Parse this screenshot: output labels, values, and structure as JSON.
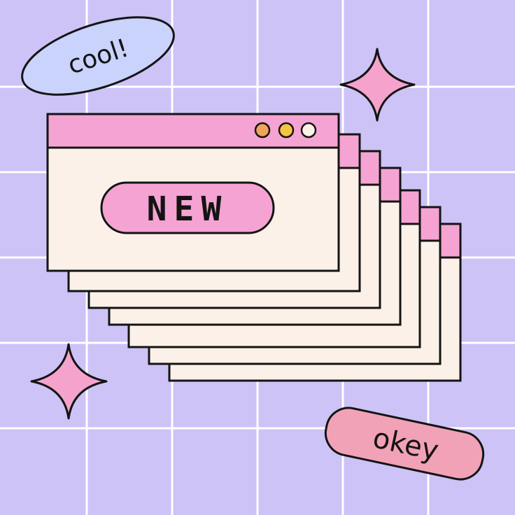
{
  "colors": {
    "background": "#cdc3f7",
    "grid_line": "#ffffff",
    "window_cream": "#fbf1e8",
    "titlebar_pink": "#f5a3d2",
    "button_pink": "#f5a3d2",
    "outline": "#141414",
    "cool_bubble": "#c9d3fb",
    "okey_bubble": "#f2a2b6",
    "sparkle_pink": "#f5a3cc",
    "dot_orange": "#f2a35a",
    "dot_yellow": "#f5c542",
    "dot_cream": "#fbf1e8"
  },
  "main_window": {
    "button_label": "NEW",
    "control_icons": [
      "orange-dot-icon",
      "yellow-dot-icon",
      "cream-dot-icon"
    ]
  },
  "stacked_windows_count": 6,
  "stickers": {
    "cool_label": "cool!",
    "okey_label": "okey"
  },
  "decorations": [
    "sparkle-icon",
    "sparkle-icon"
  ]
}
